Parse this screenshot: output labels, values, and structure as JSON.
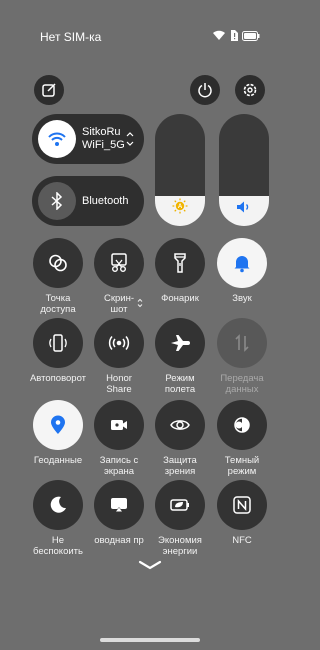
{
  "status_bar": {
    "carrier": "Нет SIM-ка"
  },
  "wifi": {
    "name": "SitkoRu",
    "ssid": "WiFi_5G"
  },
  "bluetooth": {
    "label": "Bluetooth"
  },
  "brightness": {
    "level": 0.27
  },
  "volume": {
    "level": 0.27
  },
  "tiles": [
    {
      "label": "Точка\nдоступа",
      "state": "off"
    },
    {
      "label": "Скрин-\nшот",
      "state": "off"
    },
    {
      "label": "Фонарик",
      "state": "off"
    },
    {
      "label": "Звук",
      "state": "on"
    },
    {
      "label": "Автоповорот",
      "state": "off"
    },
    {
      "label": "Honor\nShare",
      "state": "off"
    },
    {
      "label": "Режим\nполета",
      "state": "off"
    },
    {
      "label": "Передача\nданных",
      "state": "disabled"
    },
    {
      "label": "Геоданные",
      "state": "on"
    },
    {
      "label": "Запись с\nэкрана",
      "state": "off"
    },
    {
      "label": "Защита\nзрения",
      "state": "off"
    },
    {
      "label": "Темный\nрежим",
      "state": "off"
    },
    {
      "label": "Не\nбеспокоить",
      "state": "off"
    },
    {
      "label": "оводная пр",
      "state": "off"
    },
    {
      "label": "Экономия\nэнергии",
      "state": "off"
    },
    {
      "label": "NFC",
      "state": "off"
    }
  ],
  "colors": {
    "accent": "#1f74f0",
    "background": "#6e6e6e",
    "tile_off": "#333333",
    "tile_on": "#f5f5f5"
  }
}
